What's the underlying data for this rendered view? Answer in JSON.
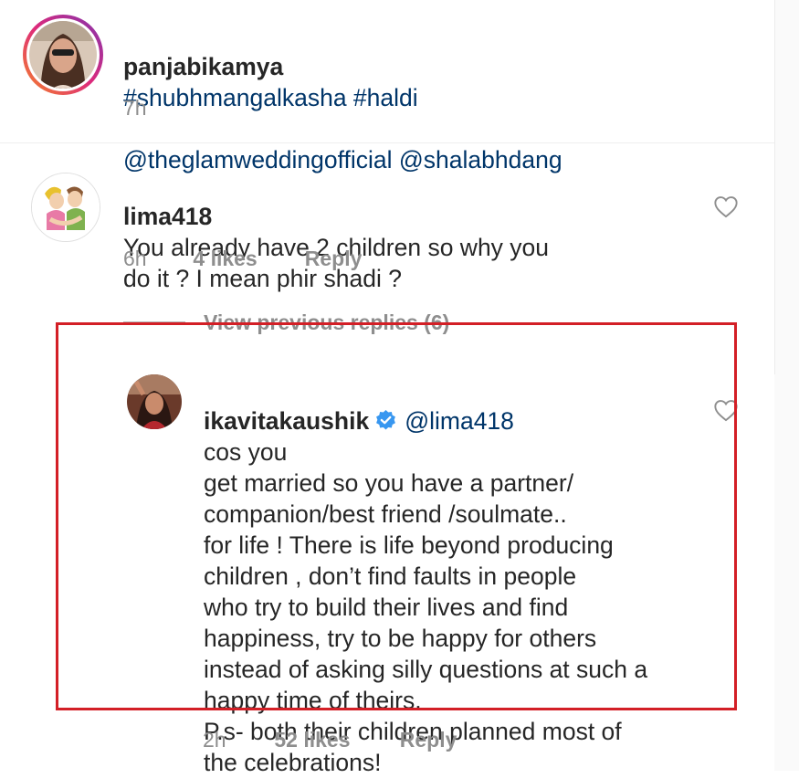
{
  "post": {
    "username": "panjabikamya",
    "caption_hashtags": "#shubhmangalkasha #haldi",
    "caption_mentions": "@theglamweddingofficial @shalabhdang",
    "time": "7h"
  },
  "comment": {
    "username": "lima418",
    "text": "You already have 2 children so why you\ndo it ? I mean phir shadi ?",
    "time": "6h",
    "likes": "4 likes",
    "reply_label": "Reply"
  },
  "view_previous_replies": "View previous replies (6)",
  "reply": {
    "username": "ikavitakaushik",
    "mention": "@lima418",
    "text_first_line": "cos you",
    "text_rest": "get married so you have a partner/\ncompanion/best friend /soulmate..\nfor life ! There is life beyond producing\nchildren , don’t find faults in people\nwho try to build their lives and find\nhappiness, try to be happy for others\ninstead of asking silly questions at such a\nhappy time of theirs.\nP.s- both their children planned most of\nthe celebrations!",
    "time": "2h",
    "likes": "52 likes",
    "reply_label": "Reply"
  },
  "colors": {
    "highlight_border": "#d31f26",
    "verified_badge": "#3897f0",
    "meta_gray": "#8e8e8e",
    "story_ring": [
      "#f58529",
      "#dd2a7b",
      "#8134af"
    ]
  },
  "icons": {
    "comment_like": "heart-outline-icon",
    "verified": "verified-badge-icon"
  }
}
